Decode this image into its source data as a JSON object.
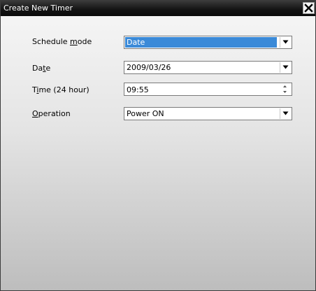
{
  "window": {
    "title": "Create New Timer",
    "close_icon": "close-x-icon"
  },
  "form": {
    "schedule_mode": {
      "label_pre": "Schedule ",
      "label_key": "m",
      "label_post": "ode",
      "value": "Date",
      "icon": "chevron-down-icon"
    },
    "date": {
      "label_pre": "Da",
      "label_key": "t",
      "label_post": "e",
      "value": "2009/03/26",
      "icon": "chevron-down-icon"
    },
    "time": {
      "label_pre": "T",
      "label_key": "i",
      "label_post": "me (24 hour)",
      "value": "09:55",
      "icon_up": "spin-up-icon",
      "icon_down": "spin-down-icon"
    },
    "operation": {
      "label_pre": "",
      "label_key": "O",
      "label_post": "peration",
      "value": "Power ON",
      "icon": "chevron-down-icon"
    }
  },
  "colors": {
    "titlebar": "#111111",
    "selection": "#3b8ad8"
  }
}
